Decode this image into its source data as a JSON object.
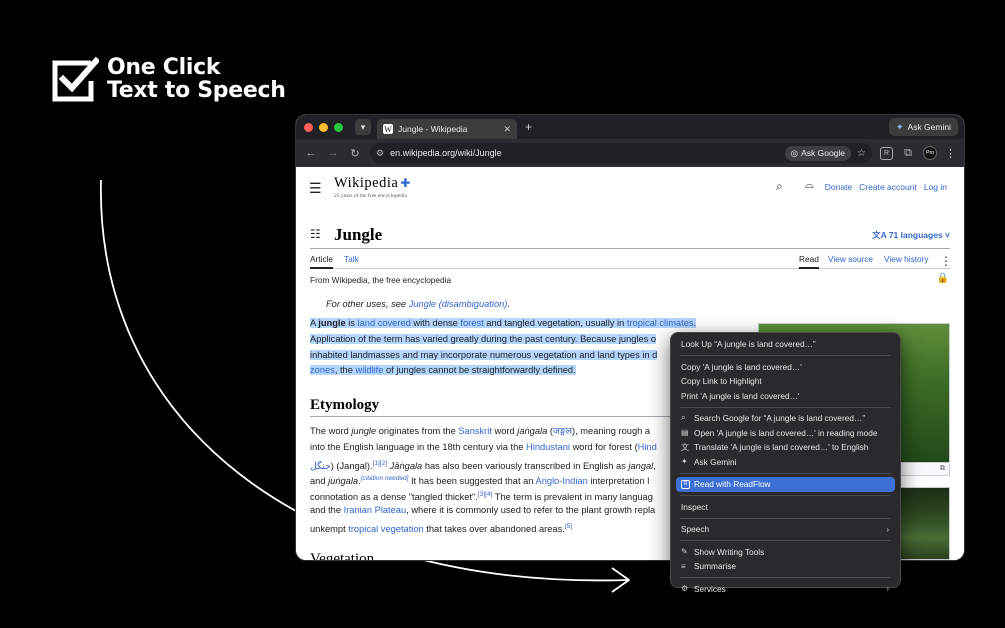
{
  "brand": {
    "line1": "One Click",
    "line2": "Text to Speech"
  },
  "colors": {
    "accent_link": "#3366cc",
    "selection": "#b4d5fe",
    "menu_highlight": "#3b6fd6",
    "background": "#000000"
  },
  "browser": {
    "tab_title": "Jungle - Wikipedia",
    "tab_favicon": "W",
    "gemini_label": "Ask Gemini",
    "url": "en.wikipedia.org/wiki/Jungle",
    "ask_google_label": "Ask Google",
    "avatar_label": "Pro"
  },
  "wiki": {
    "logo_name": "Wikipedia",
    "logo_tagline": "25 years of the free encyclopedia",
    "header_links": [
      "Donate",
      "Create account",
      "Log in"
    ],
    "page_title": "Jungle",
    "languages": "71 languages",
    "tabs": {
      "article": "Article",
      "talk": "Talk",
      "read": "Read",
      "view_source": "View source",
      "view_history": "View history"
    },
    "from_wikipedia": "From Wikipedia, the free encyclopedia",
    "hatnote_prefix": "For other uses, see ",
    "hatnote_link": "Jungle (disambiguation)",
    "hatnote_suffix": ".",
    "etymology_heading": "Etymology",
    "next_heading": "Vegetation"
  },
  "context_menu": {
    "look_up": "Look Up “A jungle is land covered…”",
    "copy": "Copy 'A jungle is land covered…'",
    "copy_link": "Copy Link to Highlight",
    "print": "Print 'A jungle is land covered…'",
    "search_google": "Search Google for “A jungle is land covered…”",
    "open_reading": "Open 'A jungle is land covered…' in reading mode",
    "translate": "Translate 'A jungle is land covered…' to English",
    "ask_gemini": "Ask Gemini",
    "read_with_readflow": "Read with ReadFlow",
    "inspect": "Inspect",
    "speech": "Speech",
    "writing_tools": "Show Writing Tools",
    "summarise": "Summarise",
    "services": "Services"
  }
}
